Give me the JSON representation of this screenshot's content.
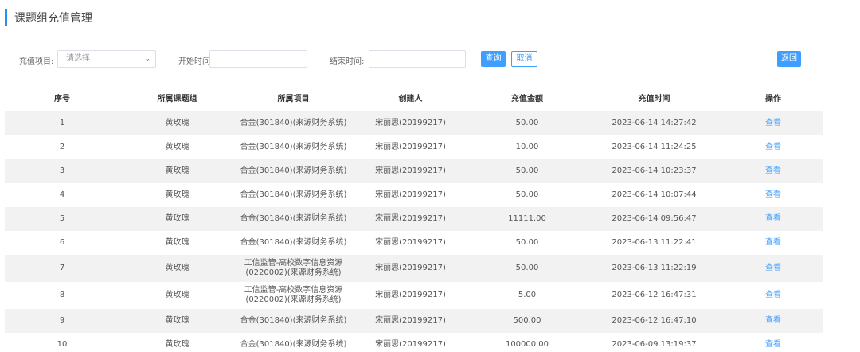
{
  "page": {
    "title": "课题组充值管理"
  },
  "filters": {
    "project_label": "充值项目:",
    "project_placeholder": "请选择",
    "start_label": "开始时间",
    "start_value": "",
    "end_label": "结束时间:",
    "end_value": "",
    "search_label": "查询",
    "cancel_label": "取消",
    "back_label": "返回"
  },
  "table": {
    "columns": [
      "序号",
      "所属课题组",
      "所属项目",
      "创建人",
      "充值金额",
      "充值时间",
      "操作"
    ],
    "rows": [
      {
        "no": "1",
        "group": "黄玫瑰",
        "project": "合金(301840)(来源财务系统)",
        "creator": "宋丽思(20199217)",
        "amount": "50.00",
        "time": "2023-06-14 14:27:42",
        "action": "查看"
      },
      {
        "no": "2",
        "group": "黄玫瑰",
        "project": "合金(301840)(来源财务系统)",
        "creator": "宋丽思(20199217)",
        "amount": "10.00",
        "time": "2023-06-14 11:24:25",
        "action": "查看"
      },
      {
        "no": "3",
        "group": "黄玫瑰",
        "project": "合金(301840)(来源财务系统)",
        "creator": "宋丽思(20199217)",
        "amount": "50.00",
        "time": "2023-06-14 10:23:37",
        "action": "查看"
      },
      {
        "no": "4",
        "group": "黄玫瑰",
        "project": "合金(301840)(来源财务系统)",
        "creator": "宋丽思(20199217)",
        "amount": "50.00",
        "time": "2023-06-14 10:07:44",
        "action": "查看"
      },
      {
        "no": "5",
        "group": "黄玫瑰",
        "project": "合金(301840)(来源财务系统)",
        "creator": "宋丽思(20199217)",
        "amount": "11111.00",
        "time": "2023-06-14 09:56:47",
        "action": "查看"
      },
      {
        "no": "6",
        "group": "黄玫瑰",
        "project": "合金(301840)(来源财务系统)",
        "creator": "宋丽思(20199217)",
        "amount": "50.00",
        "time": "2023-06-13 11:22:41",
        "action": "查看"
      },
      {
        "no": "7",
        "group": "黄玫瑰",
        "project": "工信监管-高校数字信息资源",
        "project2": "(0220002)(来源财务系统)",
        "creator": "宋丽思(20199217)",
        "amount": "50.00",
        "time": "2023-06-13 11:22:19",
        "action": "查看"
      },
      {
        "no": "8",
        "group": "黄玫瑰",
        "project": "工信监管-高校数字信息资源",
        "project2": "(0220002)(来源财务系统)",
        "creator": "宋丽思(20199217)",
        "amount": "5.00",
        "time": "2023-06-12 16:47:31",
        "action": "查看"
      },
      {
        "no": "9",
        "group": "黄玫瑰",
        "project": "合金(301840)(来源财务系统)",
        "creator": "宋丽思(20199217)",
        "amount": "500.00",
        "time": "2023-06-12 16:47:10",
        "action": "查看"
      },
      {
        "no": "10",
        "group": "黄玫瑰",
        "project": "合金(301840)(来源财务系统)",
        "creator": "宋丽思(20199217)",
        "amount": "100000.00",
        "time": "2023-06-09 13:19:37",
        "action": "查看"
      }
    ]
  },
  "colors": {
    "accent": "#2d8cf0",
    "primary": "#409eff",
    "stripe": "#f2f2f2"
  }
}
